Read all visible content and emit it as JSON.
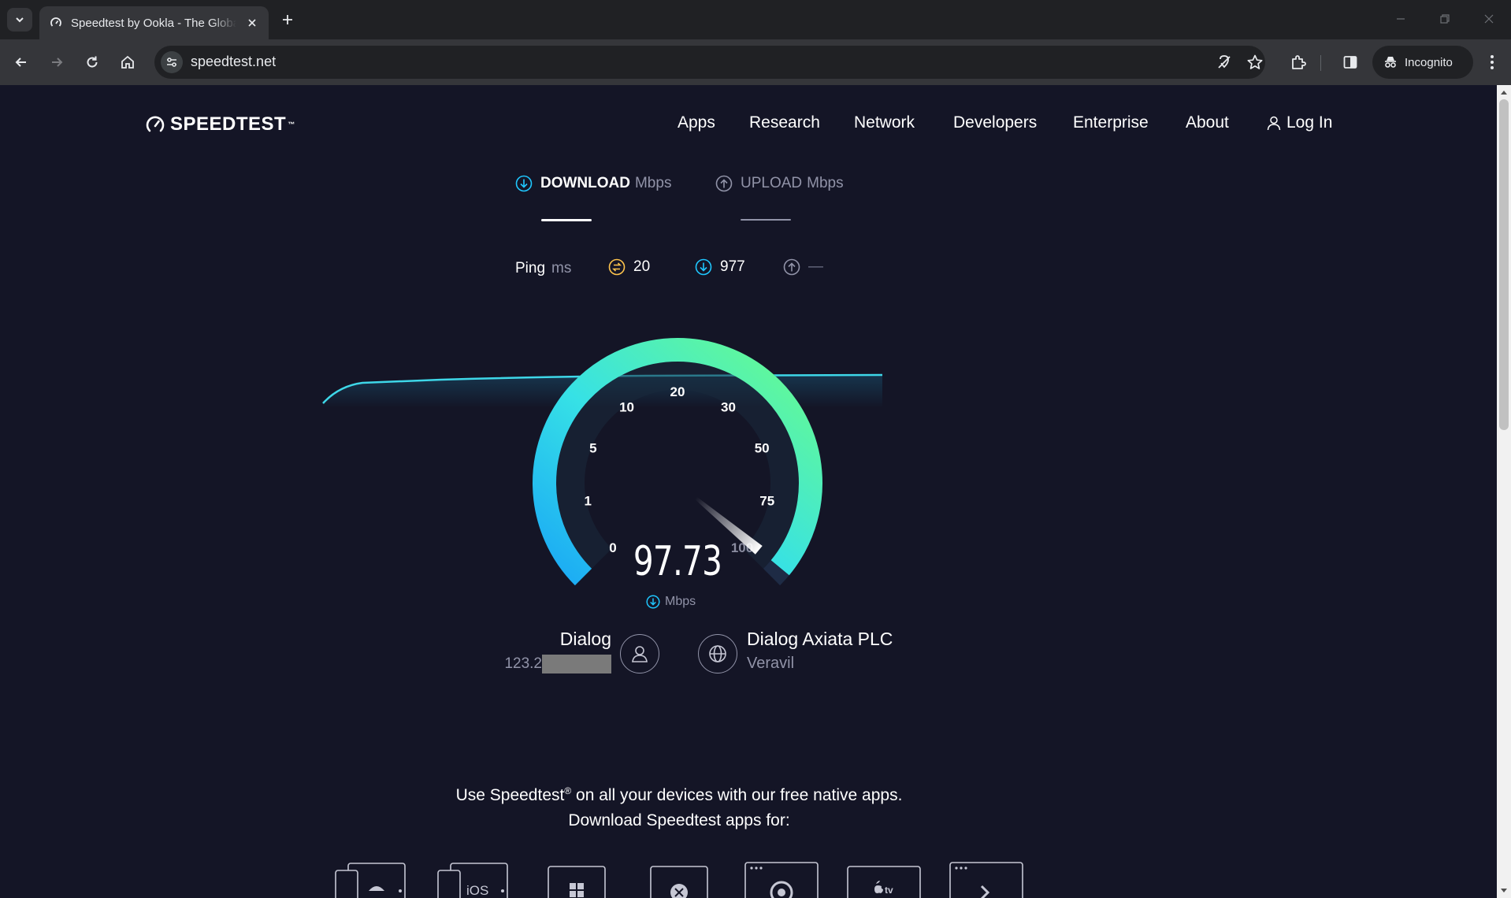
{
  "browser": {
    "tab_title": "Speedtest by Ookla - The Global Broadband Speed Test",
    "url": "speedtest.net",
    "incognito_label": "Incognito"
  },
  "nav": {
    "logo": "SPEEDTEST",
    "items": [
      "Apps",
      "Research",
      "Network",
      "Developers",
      "Enterprise",
      "About"
    ],
    "login": "Log In"
  },
  "test": {
    "download_label": "DOWNLOAD",
    "download_unit": "Mbps",
    "upload_label": "UPLOAD",
    "upload_unit": "Mbps",
    "ping_label": "Ping",
    "ping_unit": "ms",
    "ping_value": "20",
    "ping_download": "977",
    "ping_upload": "—",
    "speed_value": "97.73",
    "speed_unit": "Mbps",
    "gauge_labels": [
      "0",
      "1",
      "5",
      "10",
      "20",
      "30",
      "50",
      "75",
      "100"
    ],
    "gauge_level": 0.98
  },
  "isp": {
    "name": "Dialog",
    "ip_prefix": "123.2"
  },
  "server": {
    "name": "Dialog Axiata PLC",
    "location": "Veravil"
  },
  "promo": {
    "line1_a": "Use Speedtest",
    "line1_reg": "®",
    "line1_b": " on all your devices with our free native apps.",
    "line2": "Download Speedtest apps for:"
  },
  "devices": [
    "android",
    "ios",
    "windows",
    "mac",
    "chrome",
    "apple-tv",
    "cli"
  ],
  "colors": {
    "page_bg": "#141526",
    "accent_cyan": "#1fc7ff",
    "accent_green": "#6afd8a",
    "ping_yellow": "#fec44c"
  }
}
